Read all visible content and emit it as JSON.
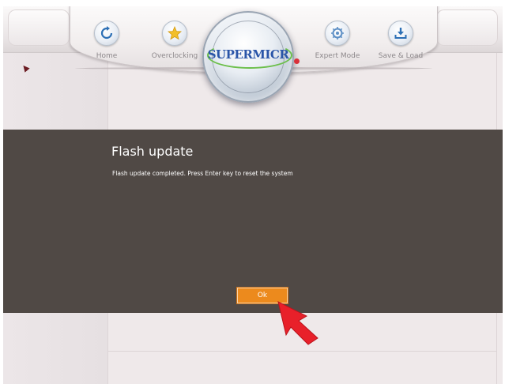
{
  "nav": {
    "items": [
      {
        "label": "Home",
        "icon": "refresh-icon"
      },
      {
        "label": "Overclocking",
        "icon": "star-icon"
      },
      {
        "label": "Expert Mode",
        "icon": "gear-icon"
      },
      {
        "label": "Save & Load",
        "icon": "download-icon"
      }
    ],
    "logo": "SUPERMICR"
  },
  "dialog": {
    "title": "Flash update",
    "message": "Flash update completed. Press Enter key to reset the system",
    "ok_label": "Ok"
  },
  "colors": {
    "dialog_bg": "#504945",
    "ok_button": "#ec8a1d",
    "pointer": "#e8202a",
    "logo_text": "#2a55a8"
  }
}
